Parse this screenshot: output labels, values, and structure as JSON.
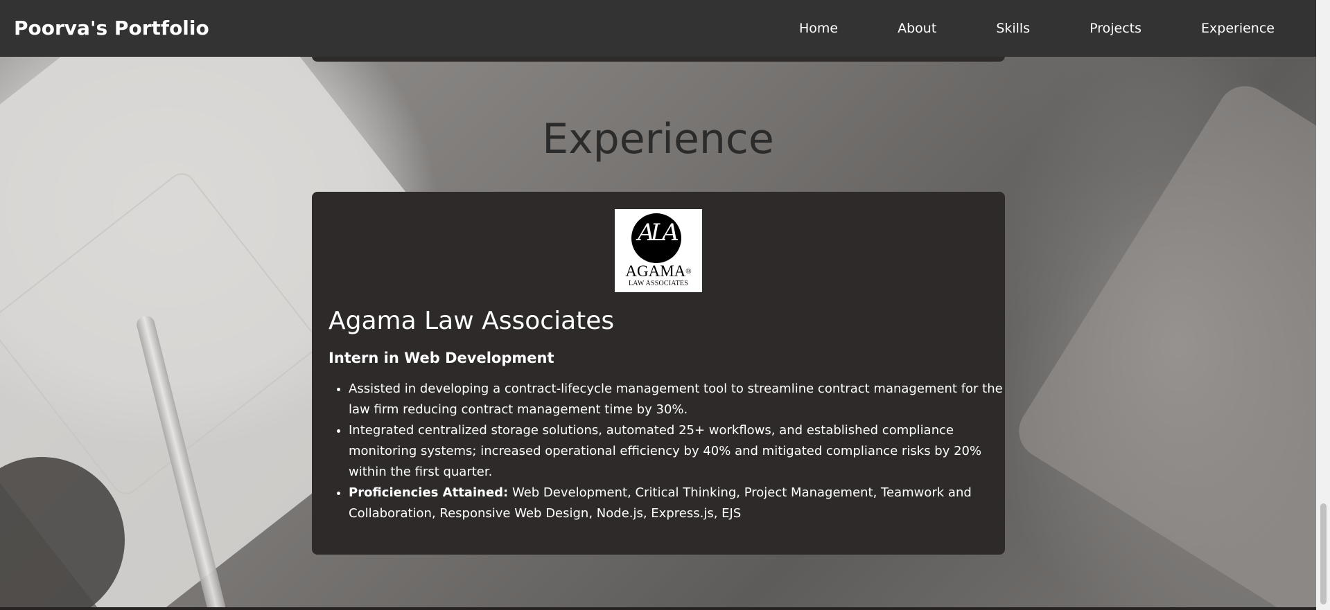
{
  "navbar": {
    "brand": "Poorva's Portfolio",
    "links": [
      "Home",
      "About",
      "Skills",
      "Projects",
      "Experience"
    ]
  },
  "section": {
    "title": "Experience"
  },
  "experience": [
    {
      "logo": {
        "name": "AGAMA",
        "registered": "®",
        "subtitle": "LAW ASSOCIATES",
        "monogram": "ALA"
      },
      "company": "Agama Law Associates",
      "role": "Intern in Web Development",
      "bullets": [
        "Assisted in developing a contract-lifecycle management tool to streamline contract management for the law firm reducing contract management time by 30%.",
        "Integrated centralized storage solutions, automated 25+ workflows, and established compliance monitoring systems; increased operational efficiency by 40% and mitigated compliance risks by 20% within the first quarter."
      ],
      "proficiencies_label": "Proficiencies Attained:",
      "proficiencies_text": " Web Development, Critical Thinking, Project Management, Teamwork and Collaboration, Responsive Web Design, Node.js, Express.js, EJS"
    }
  ],
  "colors": {
    "navbar": "#333333",
    "card": "#2e2a29",
    "title": "#2b2b2b"
  }
}
